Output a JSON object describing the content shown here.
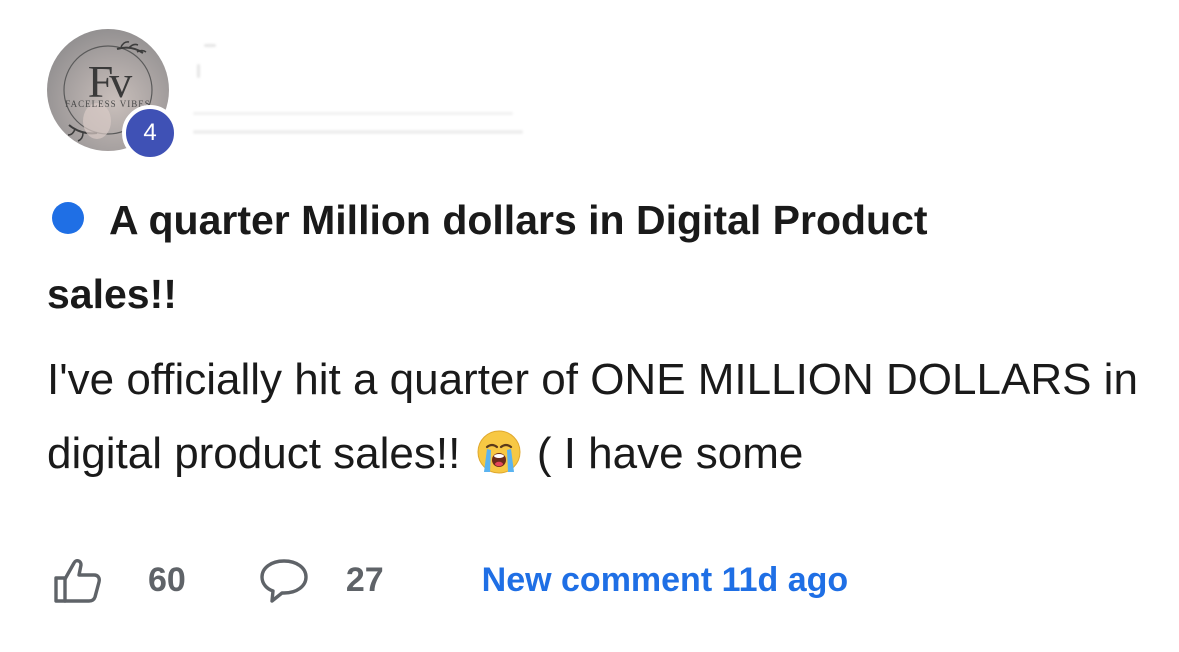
{
  "author": {
    "avatar": {
      "monogram": "Fv",
      "tagline": "FACELESS VIBES"
    },
    "level": "4"
  },
  "post": {
    "title": "A quarter Million dollars in Digital Product sales!!",
    "body_before_emoji": "I've officially hit a quarter of ONE MILLION DOLLARS in digital product sales!!",
    "emoji": "loudly-crying-face",
    "body_after_emoji": "( I have some"
  },
  "stats": {
    "likes": "60",
    "comments": "27",
    "new_comment": "New comment 11d ago"
  },
  "colors": {
    "accent_blue": "#1f6fe5",
    "level_badge": "#3f51b5",
    "icon_gray": "#5f6368",
    "text": "#1a1a1a"
  }
}
